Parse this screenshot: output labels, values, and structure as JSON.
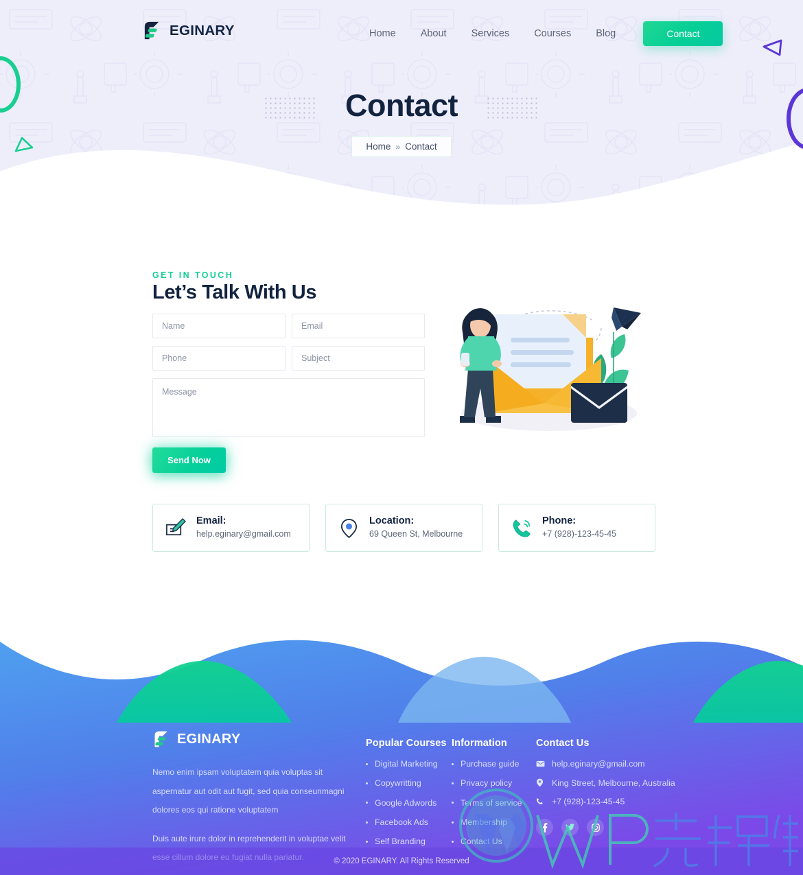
{
  "header": {
    "brand": "EGINARY",
    "nav": [
      {
        "label": "Home"
      },
      {
        "label": "About"
      },
      {
        "label": "Services"
      },
      {
        "label": "Courses"
      },
      {
        "label": "Blog"
      }
    ],
    "cta": "Contact"
  },
  "hero": {
    "title": "Contact",
    "breadcrumb_home": "Home",
    "breadcrumb_sep": "»",
    "breadcrumb_current": "Contact"
  },
  "contact": {
    "eyebrow": "GET IN TOUCH",
    "title": "Let’s Talk With Us",
    "form": {
      "name_placeholder": "Name",
      "email_placeholder": "Email",
      "phone_placeholder": "Phone",
      "subject_placeholder": "Subject",
      "message_placeholder": "Message",
      "submit_label": "Send Now"
    },
    "cards": [
      {
        "icon": "email-pencil-icon",
        "label": "Email:",
        "value": "help.eginary@gmail.com"
      },
      {
        "icon": "map-pin-icon",
        "label": "Location:",
        "value": "69 Queen St, Melbourne"
      },
      {
        "icon": "phone-icon",
        "label": "Phone:",
        "value": "+7 (928)-123-45-45"
      }
    ]
  },
  "footer": {
    "brand": "EGINARY",
    "about_p1": "Nemo enim ipsam voluptatem quia voluptas sit aspernatur aut odit aut fugit, sed quia conseunmagni dolores eos qui ratione voluptatem",
    "about_p2": "Duis aute irure dolor in reprehenderit in voluptae velit esse cillum dolore eu fugiat nulla pariatur.",
    "courses": {
      "title": "Popular Courses",
      "items": [
        "Digital Marketing",
        "Copywritting",
        "Google Adwords",
        "Facebook Ads",
        "Self Branding"
      ]
    },
    "information": {
      "title": "Information",
      "items": [
        "Purchase guide",
        "Privacy policy",
        "Terms of service",
        "Membership",
        "Contact Us"
      ]
    },
    "contact": {
      "title": "Contact Us",
      "items": [
        {
          "icon": "mail-icon",
          "text": "help.eginary@gmail.com"
        },
        {
          "icon": "map-pin-icon",
          "text": "King Street, Melbourne, Australia"
        },
        {
          "icon": "phone-icon",
          "text": "+7 (928)-123-45-45"
        }
      ]
    },
    "socials": [
      {
        "icon": "facebook-icon"
      },
      {
        "icon": "twitter-icon"
      },
      {
        "icon": "instagram-icon"
      }
    ],
    "copyright": "© 2020 EGINARY. All Rights Reserved"
  },
  "watermark": {
    "text": "WP资源海"
  },
  "colors": {
    "accent_green": "#06cf96",
    "dark_navy": "#12233f",
    "hero_bg": "#eeeefb",
    "purple": "#5b36d6",
    "footer_blue": "#4b8df0"
  }
}
